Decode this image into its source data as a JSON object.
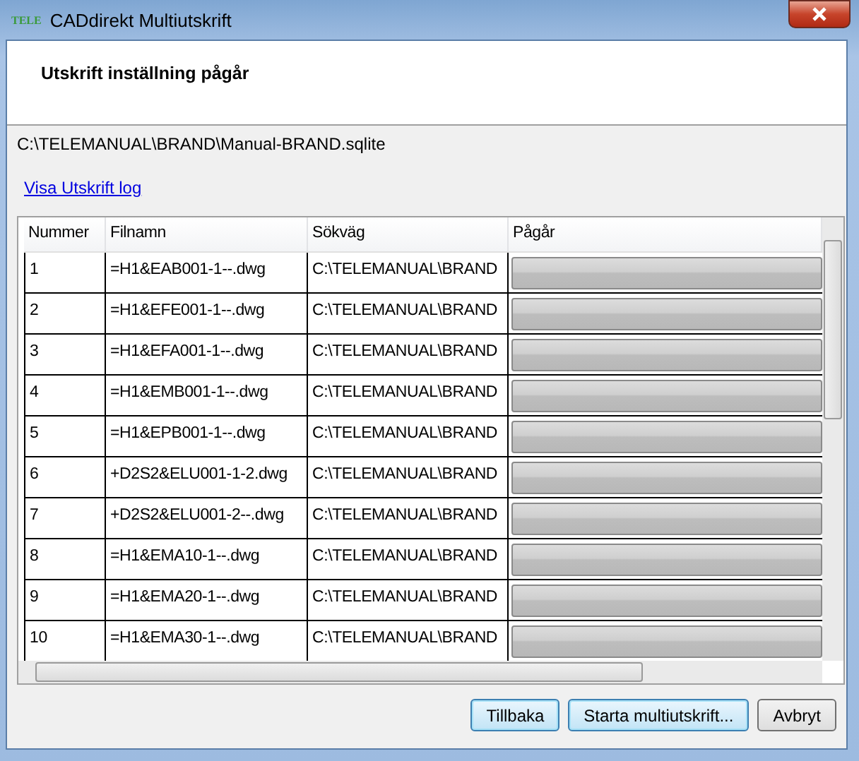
{
  "window": {
    "title": "CADdirekt Multiutskrift",
    "logo": "TELE"
  },
  "header": {
    "title": "Utskrift inställning pågår"
  },
  "path": "C:\\TELEMANUAL\\BRAND\\Manual-BRAND.sqlite",
  "log_link": "Visa Utskrift log",
  "table": {
    "columns": [
      "Nummer",
      "Filnamn",
      "Sökväg",
      "Pågår"
    ],
    "rows": [
      {
        "number": "1",
        "file": "=H1&EAB001-1--.dwg",
        "path": "C:\\TELEMANUAL\\BRAND",
        "level": 0
      },
      {
        "number": "2",
        "file": "=H1&EFE001-1--.dwg",
        "path": "C:\\TELEMANUAL\\BRAND",
        "level": 0
      },
      {
        "number": "3",
        "file": "=H1&EFA001-1--.dwg",
        "path": "C:\\TELEMANUAL\\BRAND",
        "level": 0
      },
      {
        "number": "4",
        "file": "=H1&EMB001-1--.dwg",
        "path": "C:\\TELEMANUAL\\BRAND",
        "level": 0
      },
      {
        "number": "5",
        "file": "=H1&EPB001-1--.dwg",
        "path": "C:\\TELEMANUAL\\BRAND",
        "level": 0
      },
      {
        "number": "6",
        "file": "+D2S2&ELU001-1-2.dwg",
        "path": "C:\\TELEMANUAL\\BRAND",
        "level": 0
      },
      {
        "number": "7",
        "file": "+D2S2&ELU001-2--.dwg",
        "path": "C:\\TELEMANUAL\\BRAND",
        "level": 0
      },
      {
        "number": "8",
        "file": "=H1&EMA10-1--.dwg",
        "path": "C:\\TELEMANUAL\\BRAND",
        "level": 0
      },
      {
        "number": "9",
        "file": "=H1&EMA20-1--.dwg",
        "path": "C:\\TELEMANUAL\\BRAND",
        "level": 0
      },
      {
        "number": "10",
        "file": "=H1&EMA30-1--.dwg",
        "path": "C:\\TELEMANUAL\\BRAND",
        "level": 0
      }
    ]
  },
  "buttons": [
    {
      "label": "Tillbaka",
      "focused": true
    },
    {
      "label": "Starta multiutskrift...",
      "focused": true
    },
    {
      "label": "Avbryt",
      "focused": false
    }
  ]
}
